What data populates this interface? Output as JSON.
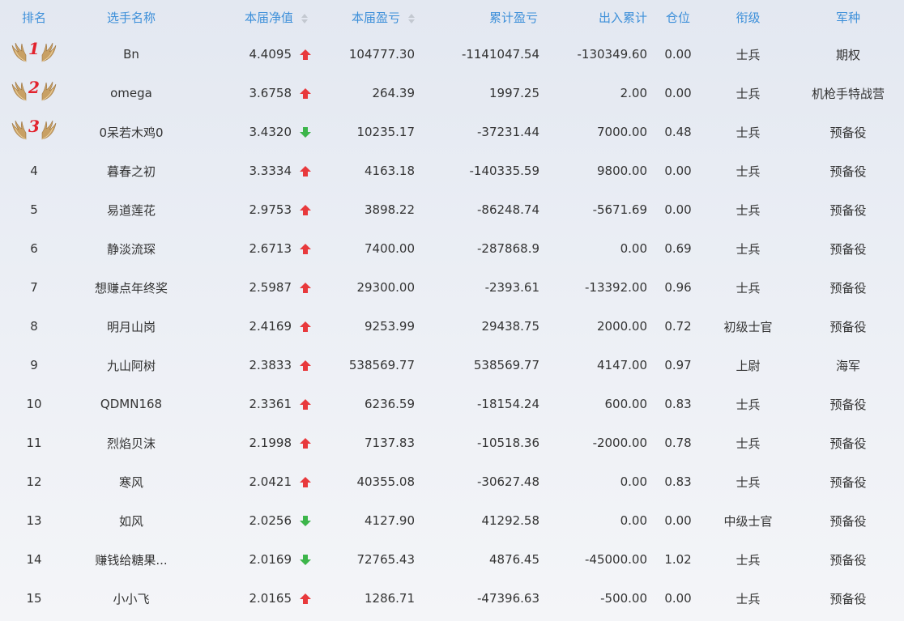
{
  "headers": {
    "rank": "排名",
    "name": "选手名称",
    "nav": "本届净值",
    "pnl": "本届盈亏",
    "cum_pnl": "累计盈亏",
    "flow": "出入累计",
    "position": "仓位",
    "title": "衔级",
    "branch": "军种"
  },
  "colors": {
    "header_text": "#3d8fd9",
    "up_arrow": "#e8393c",
    "down_arrow": "#3cb54a",
    "rank_number": "#e2222d",
    "medal_wing": "#c8a064"
  },
  "rows": [
    {
      "rank": "1",
      "name": "Bn",
      "nav": "4.4095",
      "trend": "up",
      "pnl": "104777.30",
      "cum_pnl": "-1141047.54",
      "flow": "-130349.60",
      "position": "0.00",
      "title": "士兵",
      "branch": "期权"
    },
    {
      "rank": "2",
      "name": "omega",
      "nav": "3.6758",
      "trend": "up",
      "pnl": "264.39",
      "cum_pnl": "1997.25",
      "flow": "2.00",
      "position": "0.00",
      "title": "士兵",
      "branch": "机枪手特战营"
    },
    {
      "rank": "3",
      "name": "0呆若木鸡0",
      "nav": "3.4320",
      "trend": "down",
      "pnl": "10235.17",
      "cum_pnl": "-37231.44",
      "flow": "7000.00",
      "position": "0.48",
      "title": "士兵",
      "branch": "预备役"
    },
    {
      "rank": "4",
      "name": "暮春之初",
      "nav": "3.3334",
      "trend": "up",
      "pnl": "4163.18",
      "cum_pnl": "-140335.59",
      "flow": "9800.00",
      "position": "0.00",
      "title": "士兵",
      "branch": "预备役"
    },
    {
      "rank": "5",
      "name": "易道莲花",
      "nav": "2.9753",
      "trend": "up",
      "pnl": "3898.22",
      "cum_pnl": "-86248.74",
      "flow": "-5671.69",
      "position": "0.00",
      "title": "士兵",
      "branch": "预备役"
    },
    {
      "rank": "6",
      "name": "静淡流琛",
      "nav": "2.6713",
      "trend": "up",
      "pnl": "7400.00",
      "cum_pnl": "-287868.9",
      "flow": "0.00",
      "position": "0.69",
      "title": "士兵",
      "branch": "预备役"
    },
    {
      "rank": "7",
      "name": "想赚点年终奖",
      "nav": "2.5987",
      "trend": "up",
      "pnl": "29300.00",
      "cum_pnl": "-2393.61",
      "flow": "-13392.00",
      "position": "0.96",
      "title": "士兵",
      "branch": "预备役"
    },
    {
      "rank": "8",
      "name": "明月山岗",
      "nav": "2.4169",
      "trend": "up",
      "pnl": "9253.99",
      "cum_pnl": "29438.75",
      "flow": "2000.00",
      "position": "0.72",
      "title": "初级士官",
      "branch": "预备役"
    },
    {
      "rank": "9",
      "name": "九山阿树",
      "nav": "2.3833",
      "trend": "up",
      "pnl": "538569.77",
      "cum_pnl": "538569.77",
      "flow": "4147.00",
      "position": "0.97",
      "title": "上尉",
      "branch": "海军"
    },
    {
      "rank": "10",
      "name": "QDMN168",
      "nav": "2.3361",
      "trend": "up",
      "pnl": "6236.59",
      "cum_pnl": "-18154.24",
      "flow": "600.00",
      "position": "0.83",
      "title": "士兵",
      "branch": "预备役"
    },
    {
      "rank": "11",
      "name": "烈焰贝沫",
      "nav": "2.1998",
      "trend": "up",
      "pnl": "7137.83",
      "cum_pnl": "-10518.36",
      "flow": "-2000.00",
      "position": "0.78",
      "title": "士兵",
      "branch": "预备役"
    },
    {
      "rank": "12",
      "name": "寒风",
      "nav": "2.0421",
      "trend": "up",
      "pnl": "40355.08",
      "cum_pnl": "-30627.48",
      "flow": "0.00",
      "position": "0.83",
      "title": "士兵",
      "branch": "预备役"
    },
    {
      "rank": "13",
      "name": "如风",
      "nav": "2.0256",
      "trend": "down",
      "pnl": "4127.90",
      "cum_pnl": "41292.58",
      "flow": "0.00",
      "position": "0.00",
      "title": "中级士官",
      "branch": "预备役"
    },
    {
      "rank": "14",
      "name": "赚钱给糖果...",
      "nav": "2.0169",
      "trend": "down",
      "pnl": "72765.43",
      "cum_pnl": "4876.45",
      "flow": "-45000.00",
      "position": "1.02",
      "title": "士兵",
      "branch": "预备役"
    },
    {
      "rank": "15",
      "name": "小小飞",
      "nav": "2.0165",
      "trend": "up",
      "pnl": "1286.71",
      "cum_pnl": "-47396.63",
      "flow": "-500.00",
      "position": "0.00",
      "title": "士兵",
      "branch": "预备役"
    }
  ]
}
